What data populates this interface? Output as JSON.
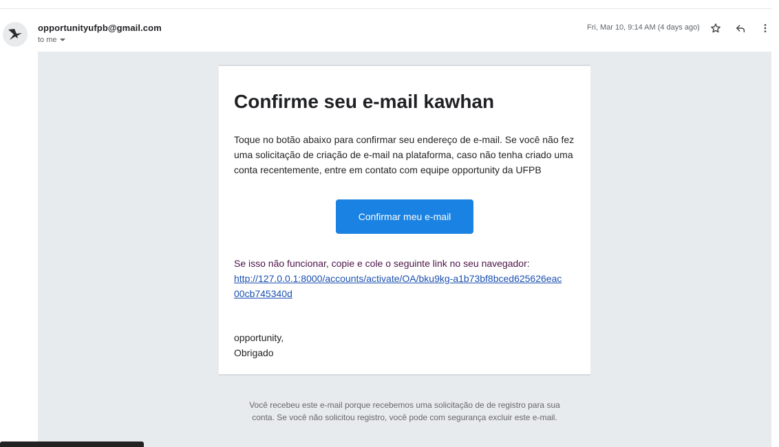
{
  "message": {
    "sender_email": "opportunityufpb@gmail.com",
    "recipient_label": "to me",
    "date": "Fri, Mar 10, 9:14 AM (4 days ago)"
  },
  "email": {
    "title": "Confirme seu e-mail kawhan",
    "body": "Toque no botão abaixo para confirmar seu endereço de e-mail. Se você não fez uma solicitação de criação de e-mail na plataforma, caso não tenha criado uma conta recentemente, entre em contato com equipe opportunity da UFPB",
    "button_label": "Confirmar meu e-mail",
    "fallback_text": "Se isso não funcionar, copie e cole o seguinte link no seu navegador:",
    "fallback_link": "http://127.0.0.1:8000/accounts/activate/OA/bku9kg-a1b73bf8bced625626eac00cb745340d",
    "sign_line1": "opportunity,",
    "sign_line2": "Obrigado",
    "footer_line1": "Você recebeu este e-mail porque recebemos uma solicitação de de registro para sua",
    "footer_line2": "conta. Se você não solicitou registro, você pode com segurança excluir este e-mail."
  },
  "icons": {
    "avatar": "bird-logo-icon",
    "star": "star-outline-icon",
    "reply": "reply-icon",
    "more": "more-vertical-icon",
    "dropdown": "caret-down-icon"
  },
  "colors": {
    "button": "#1a82e2",
    "link": "#1a4fb0",
    "fallback_text": "#4b1346",
    "email_background": "#e8ebee"
  }
}
